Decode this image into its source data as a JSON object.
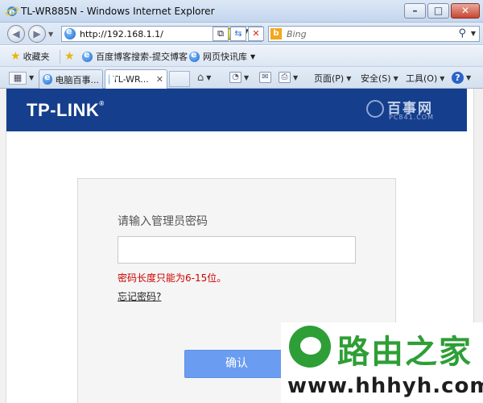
{
  "window": {
    "title": "TL-WR885N - Windows Internet Explorer"
  },
  "address_bar": {
    "url": "http://192.168.1.1/",
    "search_placeholder": "Bing"
  },
  "favorites_bar": {
    "favorites_label": "收藏夹",
    "links": [
      "百度博客搜索-提交博客",
      "网页快讯库"
    ]
  },
  "tabs": [
    {
      "label": "电脑百事..."
    },
    {
      "label": "TL-WR...",
      "active": true
    }
  ],
  "commands": {
    "page": "页面(P)",
    "safety": "安全(S)",
    "tools": "工具(O)"
  },
  "router": {
    "brand": "TP-LINK",
    "watermark_cn": "百事网",
    "watermark_en": "PC841.COM"
  },
  "login": {
    "title": "请输入管理员密码",
    "password_value": "",
    "error": "密码长度只能为6-15位。",
    "forgot": "忘记密码?",
    "confirm": "确认"
  },
  "watermark": {
    "brand": "路由之家",
    "url": "www.hhhyh.com"
  },
  "colors": {
    "header": "#153f8c",
    "button": "#6a9cf1",
    "error": "#cc0000",
    "watermark_green": "#2e9e36"
  }
}
